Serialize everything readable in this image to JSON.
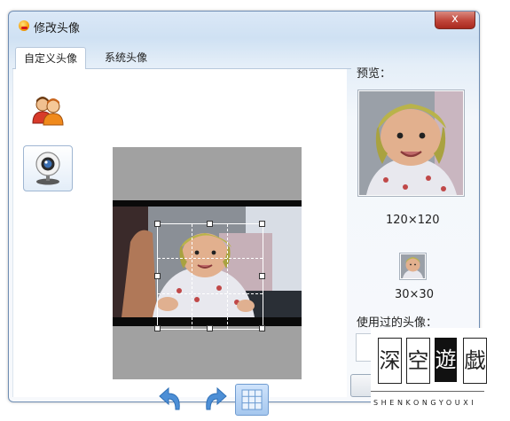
{
  "window": {
    "title": "修改头像",
    "close_label": "x"
  },
  "tabs": [
    {
      "label": "自定义头像",
      "active": true
    },
    {
      "label": "系统头像",
      "active": false
    }
  ],
  "sources": [
    "friends-icon",
    "webcam-icon"
  ],
  "toolbar": {
    "icons": [
      "rotate-left-icon",
      "rotate-right-icon",
      "grid-icon"
    ]
  },
  "preview": {
    "label": "预览：",
    "large_size": "120×120",
    "small_size": "30×30"
  },
  "used": {
    "label": "使用过的头像："
  },
  "watermark": {
    "chars": [
      "深",
      "空",
      "遊",
      "戯"
    ],
    "text": "SHENKONGYOUXI"
  }
}
